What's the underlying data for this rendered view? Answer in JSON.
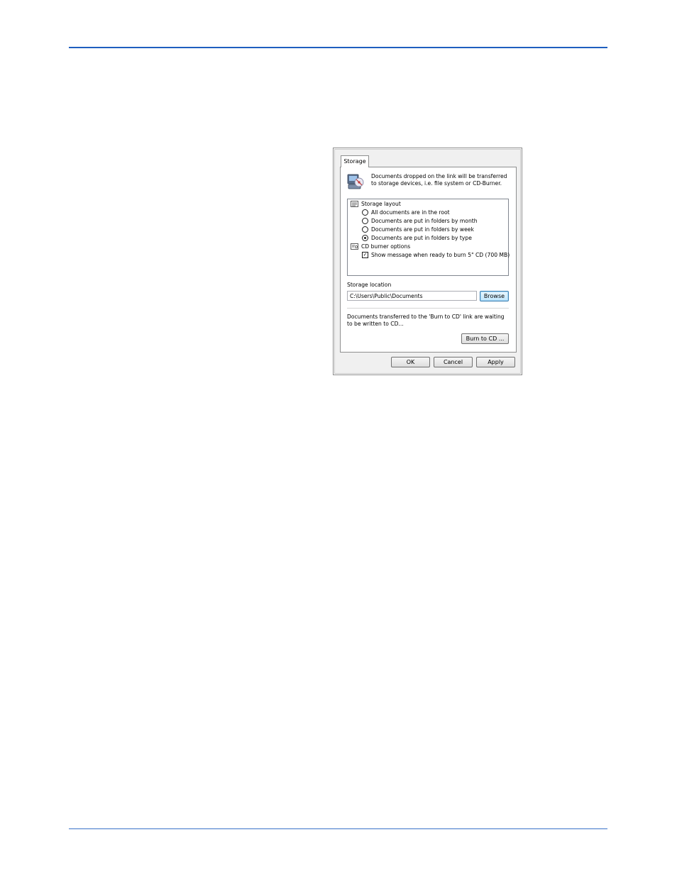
{
  "dialog": {
    "tab_label": "Storage",
    "intro_text": "Documents dropped on the link will be transferred to storage devices, i.e. file system or CD-Burner.",
    "tree": {
      "storage_layout_label": "Storage layout",
      "options": [
        {
          "label": "All documents are in the root",
          "selected": false
        },
        {
          "label": "Documents are put in folders by month",
          "selected": false
        },
        {
          "label": "Documents are put in folders by week",
          "selected": false
        },
        {
          "label": "Documents are put in folders by type",
          "selected": true
        }
      ],
      "cd_burner_label": "CD burner options",
      "cd_option_label": "Show message when ready to burn 5\" CD (700 MB)",
      "cd_option_checked": true
    },
    "storage_location_label": "Storage location",
    "storage_location_value": "C:\\Users\\Public\\Documents",
    "browse_label": "Browse",
    "burn_note": "Documents transferred to the 'Burn to CD' link are waiting to be written to CD...",
    "burn_button_label": "Burn to CD ...",
    "ok_label": "OK",
    "cancel_label": "Cancel",
    "apply_label": "Apply"
  },
  "colors": {
    "rule": "#1f5fbf",
    "dialog_bg": "#f0f0f0",
    "focus_button": "#bee6fd"
  }
}
